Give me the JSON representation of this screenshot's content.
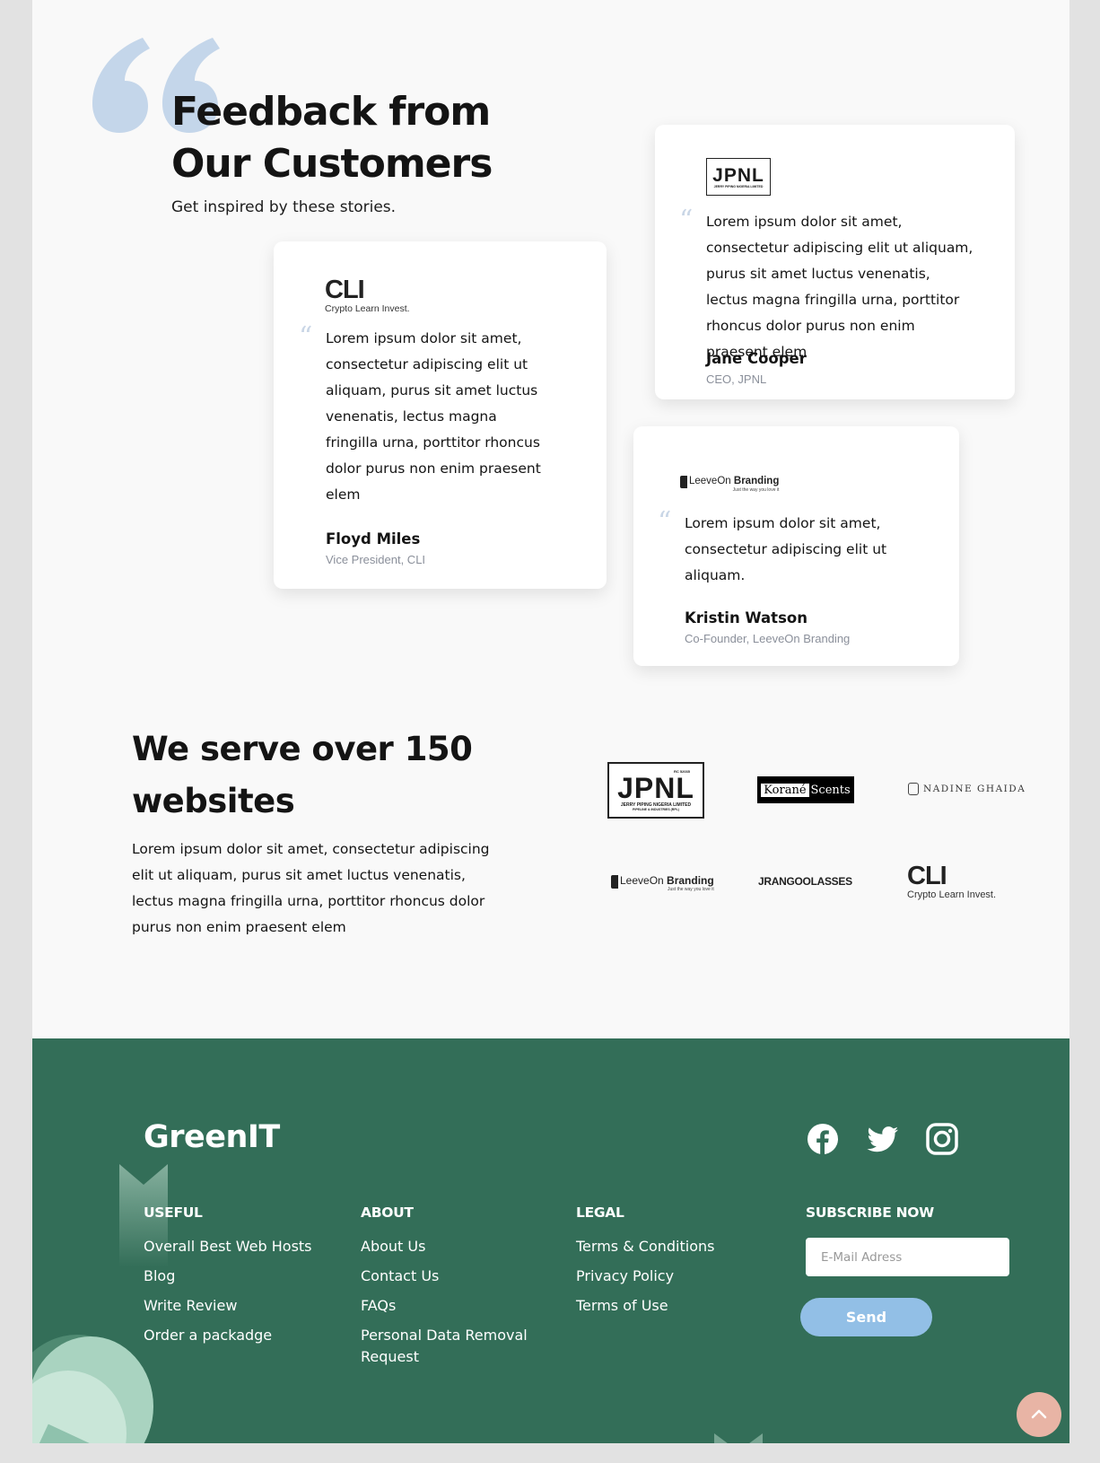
{
  "testimonials": {
    "title_line1": "Feedback from",
    "title_line2": "Our Customers",
    "subtitle": "Get inspired by these stories.",
    "cards": [
      {
        "logo_main": "CLI",
        "logo_sub": "Crypto Learn Invest.",
        "text": "Lorem ipsum dolor sit amet, consectetur adipiscing elit ut aliquam, purus sit amet luctus venenatis, lectus magna fringilla urna, porttitor rhoncus dolor purus non enim praesent elem",
        "name": "Floyd Miles",
        "role": "Vice President, CLI"
      },
      {
        "logo_main": "JPNL",
        "logo_sub": "JERRY PIPING NIGERIA LIMITED",
        "text": "Lorem ipsum dolor sit amet, consectetur adipiscing elit ut aliquam, purus sit amet luctus venenatis, lectus magna fringilla urna, porttitor rhoncus dolor purus non enim praesent elem",
        "name": "Jane Cooper",
        "role": "CEO, JPNL"
      },
      {
        "logo_main": "LeeveOn",
        "logo_bold": "Branding",
        "logo_sub": "Just the way you love it",
        "text": "Lorem ipsum dolor sit amet, consectetur adipiscing elit ut aliquam.",
        "name": "Kristin Watson",
        "role": "Co-Founder, LeeveOn Branding"
      }
    ]
  },
  "serve": {
    "title_line1": "We serve over 150",
    "title_line2": "websites",
    "text": "Lorem ipsum dolor sit amet, consectetur adipiscing elit ut aliquam, purus sit amet luctus venenatis, lectus magna fringilla urna, porttitor rhoncus dolor purus non enim praesent elem",
    "logos": {
      "jpnl_main": "JPNL",
      "jpnl_top": "RC 52035",
      "jpnl_sub": "JERRY PIPING NIGERIA LIMITED",
      "jpnl_sub2": "PIPELINE & INDUSTRIES (RPL)",
      "korane_a": "Korané",
      "korane_b": "Scents",
      "nadine": "NADINE GHAIDA",
      "leeve_main": "LeeveOn",
      "leeve_bold": "Branding",
      "leeve_sub": "Just the way you love it",
      "jrang": "JRANGOOLASSES",
      "cli_main": "CLI",
      "cli_sub": "Crypto Learn Invest."
    }
  },
  "footer": {
    "brand": "GreenIT",
    "social_icons": [
      "facebook-icon",
      "twitter-icon",
      "instagram-icon"
    ],
    "columns": [
      {
        "heading": "USEFUL",
        "links": [
          "Overall Best Web Hosts",
          "Blog",
          "Write Review",
          "Order a packadge"
        ]
      },
      {
        "heading": "ABOUT",
        "links": [
          "About Us",
          "Contact Us",
          "FAQs",
          "Personal Data Removal Request"
        ]
      },
      {
        "heading": "LEGAL",
        "links": [
          "Terms & Conditions",
          "Privacy Policy",
          "Terms of Use"
        ]
      }
    ],
    "subscribe": {
      "heading": "SUBSCRIBE NOW",
      "placeholder": "E-Mail Adress",
      "button": "Send"
    }
  },
  "colors": {
    "footer_bg": "#336e58",
    "send_button": "#92bfe6",
    "scroll_top_button": "#e8b4a5",
    "quote_mark": "#c4d6ea"
  }
}
